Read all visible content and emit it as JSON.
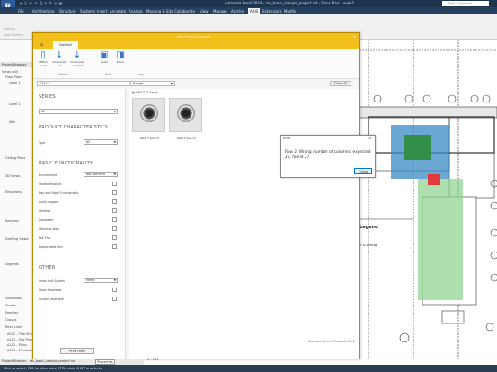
{
  "titlebar": {
    "title": "Autodesk Revit 2019 - rac_basic_sample_project.rvt - Floor Plan: Level 1",
    "search_placeholder": "Type a keyword",
    "logo": "R"
  },
  "menu": [
    "File",
    "Architecture",
    "Structure",
    "Systems",
    "Insert",
    "Annotate",
    "Analyze",
    "Massing & Site",
    "Collaborate",
    "View",
    "Manage",
    "Add-Ins",
    "AXIS",
    "Extensions",
    "Modify"
  ],
  "menu_active": "AXIS",
  "ribbon": {
    "label1": "Add-ins",
    "label2": "Axis Camera"
  },
  "project_browser": {
    "header": "Project Browser",
    "rows": [
      "Views (all)",
      "Floor Plans",
      "Level 1",
      "Level 2",
      "Site",
      "Ceiling Plans",
      "3D Views",
      "Elevations",
      "Sections",
      "Drafting Views",
      "Legends",
      "Schedules",
      "Sheets",
      "Families",
      "Groups",
      "Revit Links"
    ],
    "tail": [
      "A001 - Title Sheet",
      "A101 - Site Plan",
      "A102 - Plans",
      "A103 - Elevations/Sections"
    ]
  },
  "bottom_tabs": {
    "browser": "Project Browser - rac_basic_sample_project.rvt",
    "properties": "Properties"
  },
  "status": {
    "text": "Click to select, TAB for alternates, CTRL adds, SHIFT unselects.",
    "scale": "1 : 100"
  },
  "plugin": {
    "title": "Axis Product Selector",
    "tab": "Default",
    "ribbon_buttons": [
      {
        "label": "Offline mode"
      },
      {
        "label": "Download All"
      },
      {
        "label": "Download selected"
      },
      {
        "label": "Load"
      },
      {
        "label": "Place"
      }
    ],
    "groups": [
      "Default",
      "Tools",
      "Help"
    ],
    "search_value": "F3227",
    "range_value": "Range",
    "clear_all": "Clear All",
    "breadcrumb": "AXIS F32 Series",
    "filters": {
      "series_title": "SERIES",
      "series_value": "All",
      "product_title": "PRODUCT CHARACTERISTICS",
      "type_label": "Type",
      "type_value": "All",
      "basic_title": "BASIC FUNCTIONALITY",
      "environment_label": "Environment",
      "environment_value": "Not specified",
      "checks": [
        "Vandal resistant",
        "Day and Night Functionality",
        "Audio support",
        "Wireless",
        "Zipstream",
        "Stainless steel",
        "PoE Plus",
        "Replaceable lens"
      ],
      "other_title": "OTHER",
      "unit_label": "Show Unit System",
      "unit_value": "Metric",
      "download_label": "Show Download",
      "custom_label": "Custom Available",
      "print_filter": "Print Filter"
    },
    "products": [
      {
        "name": "AXIS F3227-E"
      },
      {
        "name": "AXIS F3227-E"
      }
    ],
    "footer": "Selected items: 1   Products: 2 / 2"
  },
  "error_dialog": {
    "title": "Error",
    "message": "Row 2: Wrong number of columns: expected 26, found 27",
    "ok": "Close"
  },
  "canvas": {
    "legend": "Legend",
    "label2": "n & Living"
  }
}
